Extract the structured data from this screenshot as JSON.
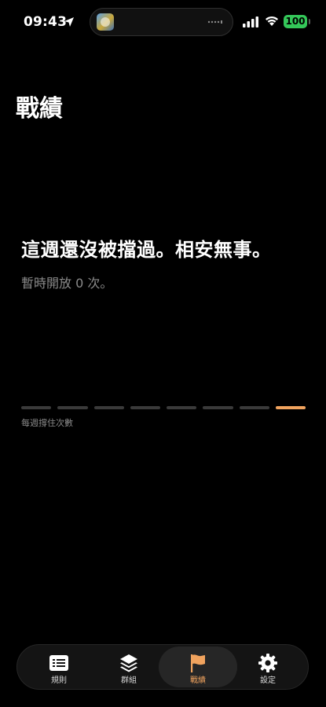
{
  "status_bar": {
    "time": "09:43",
    "battery": "100",
    "battery_color": "#34c759"
  },
  "page": {
    "title": "戰績",
    "headline": "這週還沒被擋過。相安無事。",
    "subtext": "暫時開放 0 次。"
  },
  "weekly_chart": {
    "caption": "每週撐住次數",
    "bars": [
      {
        "current": false
      },
      {
        "current": false
      },
      {
        "current": false
      },
      {
        "current": false
      },
      {
        "current": false
      },
      {
        "current": false
      },
      {
        "current": false
      },
      {
        "current": true
      }
    ],
    "inactive_color": "#3a3a3a",
    "active_color": "#f0a35e"
  },
  "tabs": [
    {
      "label": "規則",
      "icon": "list-icon",
      "active": false
    },
    {
      "label": "群組",
      "icon": "layers-icon",
      "active": false
    },
    {
      "label": "戰績",
      "icon": "flag-icon",
      "active": true
    },
    {
      "label": "設定",
      "icon": "gear-icon",
      "active": false
    }
  ],
  "colors": {
    "accent": "#f0a35e",
    "background": "#000000"
  }
}
